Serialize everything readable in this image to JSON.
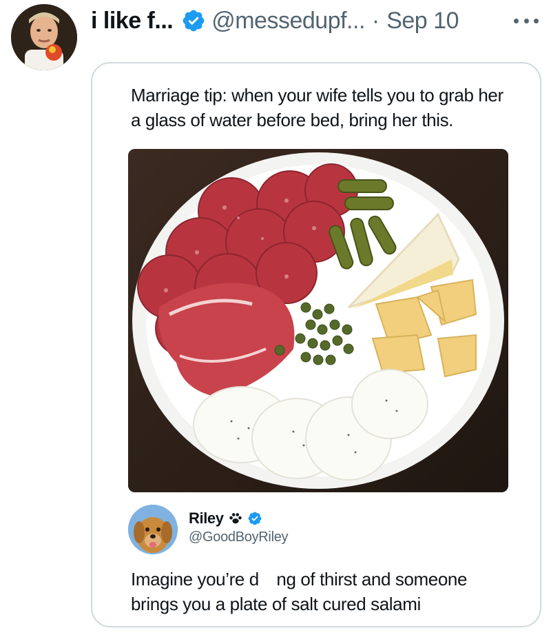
{
  "tweet": {
    "display_name": "i like f...",
    "handle": "@messedupf...",
    "separator": "·",
    "date": "Sep 10",
    "avatar_icon": "chef-avatar"
  },
  "quote": {
    "text": "Marriage tip: when your wife tells you to grab her a glass of water before bed, bring her this.",
    "media_icon": "charcuterie-plate-photo",
    "reply": {
      "display_name": "Riley",
      "handle": "@GoodBoyRiley",
      "text": "Imagine you’re d ng of thirst and someone brings you a plate of salt cured salami",
      "avatar_icon": "golden-retriever-avatar"
    }
  },
  "colors": {
    "verified_blue": "#1d9bf0",
    "secondary_text": "#536471",
    "border": "#cfd9de"
  }
}
